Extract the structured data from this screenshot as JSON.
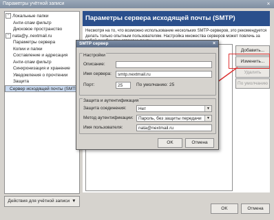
{
  "window": {
    "title": "Параметры учётной записи",
    "close_glyph": "×"
  },
  "tree": [
    {
      "label": "Локальные папки",
      "expander": "−"
    },
    {
      "label": "Анти-спам фильтр"
    },
    {
      "label": "Дисковое пространство"
    },
    {
      "label": "nata@y..nextmail.ru",
      "expander": "−"
    },
    {
      "label": "Параметры сервера"
    },
    {
      "label": "Копии и папки"
    },
    {
      "label": "Составление и адресация"
    },
    {
      "label": "Анти-спам фильтр"
    },
    {
      "label": "Синхронизация и хранение"
    },
    {
      "label": "Уведомления о прочтении"
    },
    {
      "label": "Защита"
    },
    {
      "label": "Сервер исходящей почты (SMTP",
      "selected": true
    }
  ],
  "actions_button": "Действия для учётной записи",
  "actions_arrow": "▼",
  "header": "Параметры сервера исходящей почты (SMTP)",
  "description": "Несмотря на то, что возможно использование нескольких SMTP-серверов, это рекомендуется делать только опытным пользователям. Настройка множества серверов может повлечь за собой ошибки при отправке почты.",
  "buttons_right": {
    "add": "Добавить...",
    "edit": "Изменить...",
    "remove": "Удалить",
    "default": "По умолчанию"
  },
  "footer": {
    "ok": "OK",
    "cancel": "Отмена"
  },
  "dialog": {
    "title": "SMTP сервер",
    "close_glyph": "×",
    "settings_group": "Настройки",
    "description_label": "Описание:",
    "description_value": "",
    "server_label": "Имя сервера:",
    "server_value": "smtp.nextmail.ru",
    "port_label": "Порт:",
    "port_value": "25",
    "default_port_label": "По умолчанию:",
    "default_port_value": "25",
    "security_group": "Защита и аутентификация",
    "conn_security_label": "Защита соединения:",
    "conn_security_value": "Нет",
    "auth_method_label": "Метод аутентификации:",
    "auth_method_value": "Пароль, без защиты передачи",
    "username_label": "Имя пользователя:",
    "username_value": "nata@nextmail.ru",
    "dropdown_glyph": "▼",
    "ok": "OK",
    "cancel": "Отмена"
  },
  "accent_colors": {
    "header": "#2a4f8c",
    "highlight": "#dd3333"
  }
}
